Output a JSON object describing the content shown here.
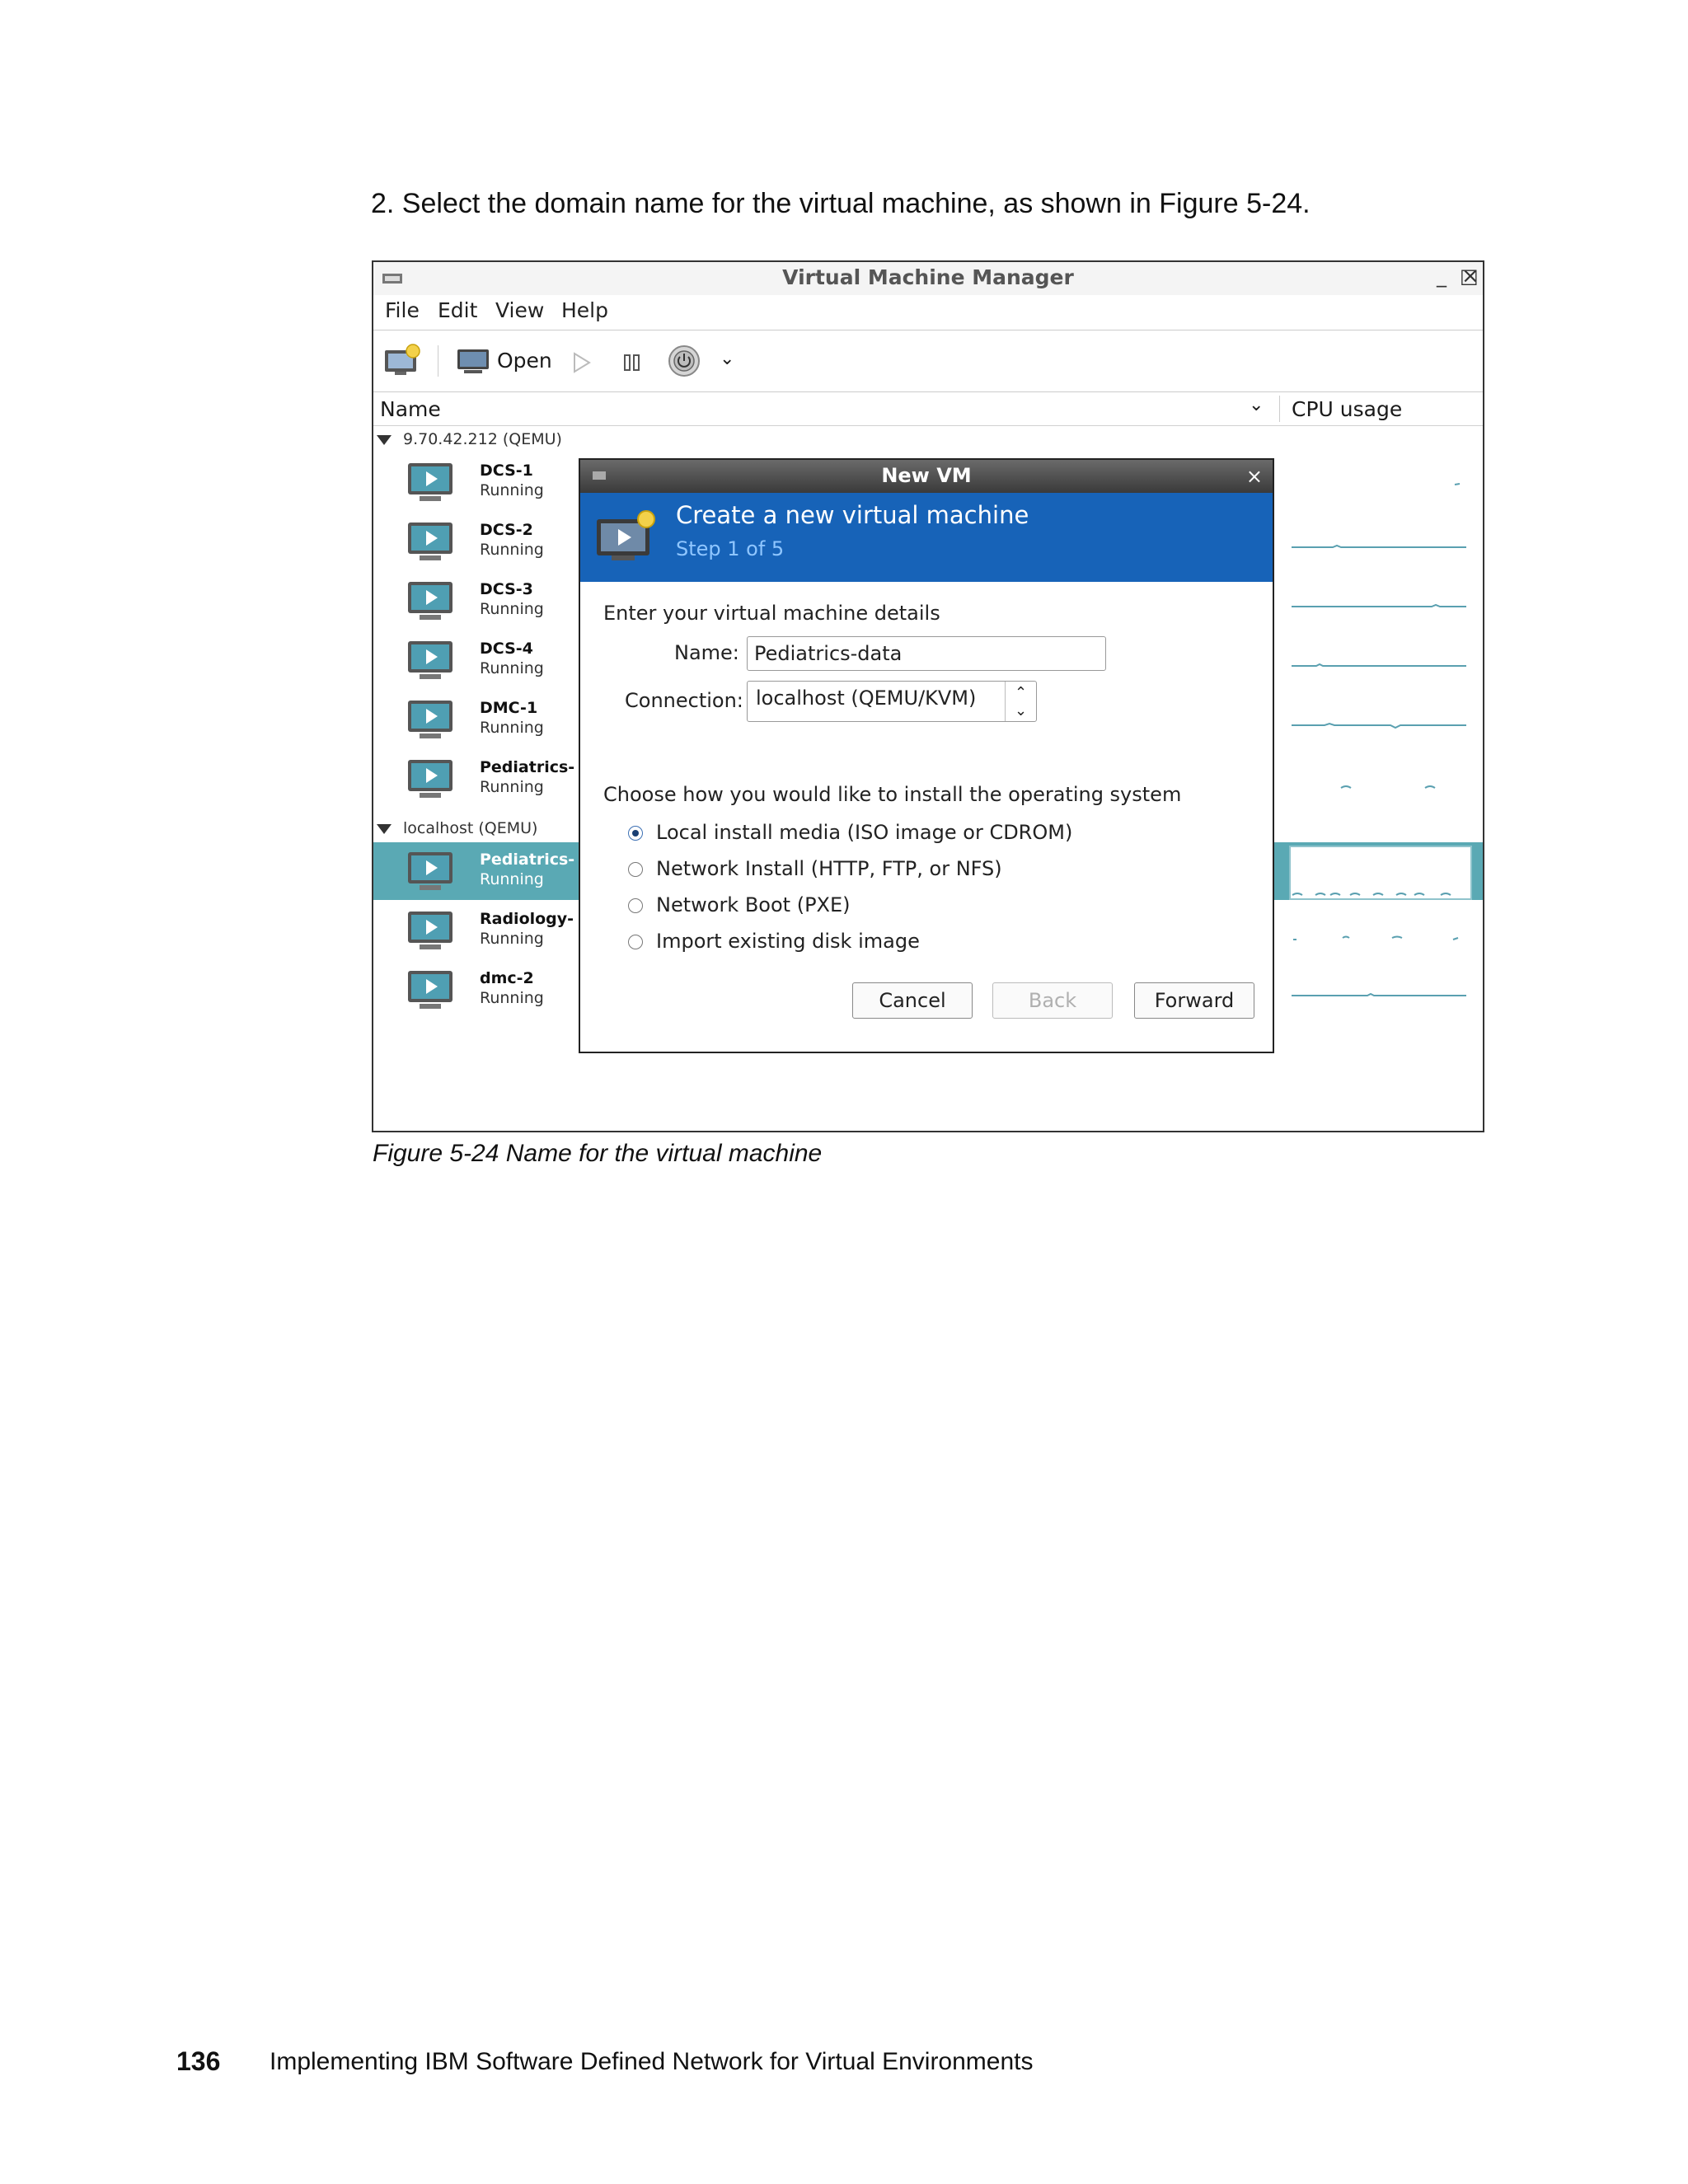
{
  "document": {
    "step_text": "2.  Select the domain name for the virtual machine, as shown in Figure 5-24.",
    "caption": "Figure 5-24   Name for the virtual machine",
    "page_number": "136",
    "footer_title": "Implementing IBM Software Defined Network for Virtual Environments"
  },
  "window": {
    "title": "Virtual Machine Manager",
    "controls": {
      "minimize": "_",
      "maximize": "□",
      "close": "×"
    },
    "menu": [
      "File",
      "Edit",
      "View",
      "Help"
    ],
    "toolbar": {
      "open_label": "Open"
    },
    "columns": {
      "name": "Name",
      "cpu": "CPU usage"
    }
  },
  "groups": [
    {
      "label": "9.70.42.212 (QEMU)",
      "vms": [
        {
          "name": "DCS-1",
          "state": "Running"
        },
        {
          "name": "DCS-2",
          "state": "Running"
        },
        {
          "name": "DCS-3",
          "state": "Running"
        },
        {
          "name": "DCS-4",
          "state": "Running"
        },
        {
          "name": "DMC-1",
          "state": "Running"
        },
        {
          "name": "Pediatrics-",
          "state": "Running"
        }
      ]
    },
    {
      "label": "localhost (QEMU)",
      "vms": [
        {
          "name": "Pediatrics-",
          "state": "Running",
          "selected": true
        },
        {
          "name": "Radiology-",
          "state": "Running"
        },
        {
          "name": "dmc-2",
          "state": "Running"
        }
      ]
    }
  ],
  "dialog": {
    "title": "New VM",
    "close": "×",
    "heading": "Create a new virtual machine",
    "step": "Step 1 of 5",
    "details_label": "Enter your virtual machine details",
    "name_label": "Name:",
    "name_value": "Pediatrics-data",
    "connection_label": "Connection:",
    "connection_value": "localhost (QEMU/KVM)",
    "install_label": "Choose how you would like to install the operating system",
    "options": [
      {
        "label": "Local install media (ISO image or CDROM)",
        "checked": true
      },
      {
        "label": "Network Install (HTTP, FTP, or NFS)",
        "checked": false
      },
      {
        "label": "Network Boot (PXE)",
        "checked": false
      },
      {
        "label": "Import existing disk image",
        "checked": false
      }
    ],
    "buttons": {
      "cancel": "Cancel",
      "back": "Back",
      "forward": "Forward"
    }
  },
  "colors": {
    "banner": "#1763b8",
    "selected_row": "#5aa9b4",
    "sparkline": "#5aa0b0"
  }
}
